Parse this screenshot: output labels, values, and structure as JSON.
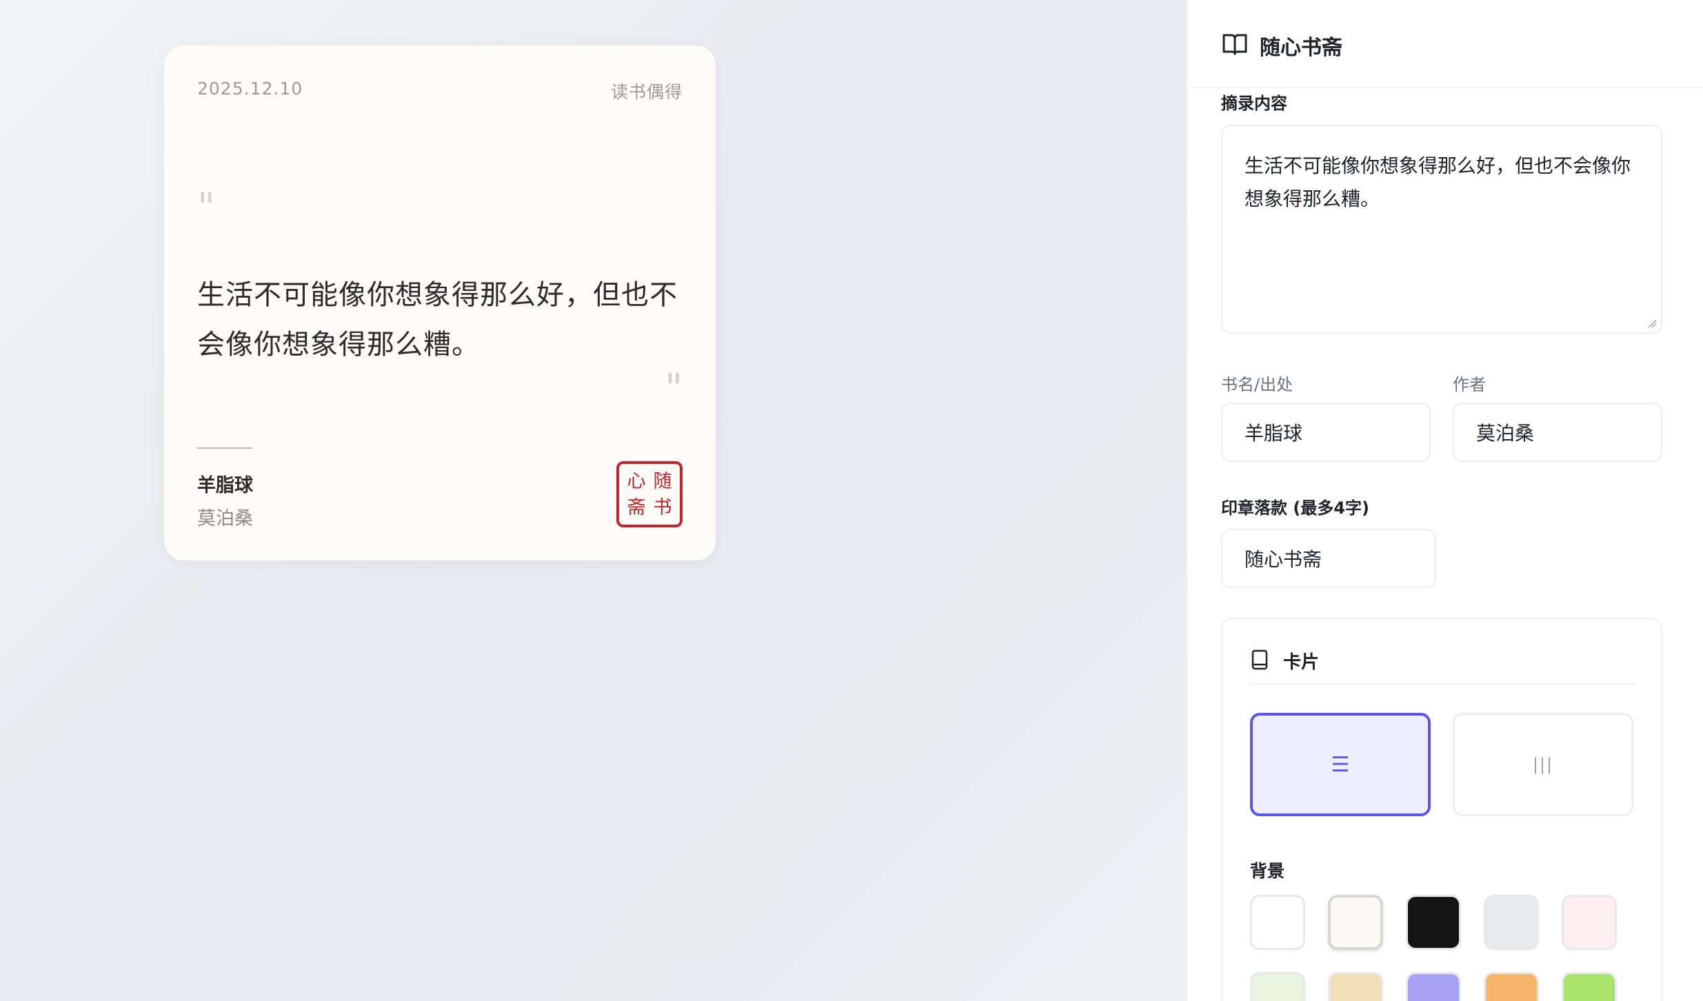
{
  "preview": {
    "date": "2025.12.10",
    "tag": "读书偶得",
    "quote_open": "\"",
    "quote_close": "\"",
    "quote": "生活不可能像你想象得那么好，但也不会像你想象得那么糟。",
    "book": "羊脂球",
    "author": "莫泊桑",
    "seal_chars": [
      "随",
      "心",
      "书",
      "斋"
    ],
    "seal_color": "#c3262a",
    "card_bg": "#fcfbf7"
  },
  "panel": {
    "app_title": "随心书斋",
    "app_icon": "open-book-icon",
    "excerpt_label": "摘录内容",
    "excerpt_value": "生活不可能像你想象得那么好，但也不会像你想象得那么糟。",
    "book_label": "书名/出处",
    "book_value": "羊脂球",
    "author_label": "作者",
    "author_value": "莫泊桑",
    "seal_label": "印章落款 (最多4字)",
    "seal_value": "随心书斋",
    "card_section": {
      "title": "卡片",
      "icon": "card-icon",
      "layouts": [
        {
          "name": "horizontal",
          "glyph": "☰",
          "selected": true
        },
        {
          "name": "vertical",
          "glyph": "|||",
          "selected": false
        }
      ],
      "accent": "#5b57e6",
      "background_label": "背景",
      "background_swatches": [
        {
          "color": "#ffffff",
          "selected": false
        },
        {
          "color": "#fbf9f3",
          "selected": true
        },
        {
          "color": "#141414",
          "selected": false
        },
        {
          "color": "#e8eaed",
          "selected": false
        },
        {
          "color": "#fdeef2",
          "selected": false
        },
        {
          "color": "#eaf5e1",
          "selected": false
        },
        {
          "color": "#f1dfb7",
          "selected": false
        },
        {
          "color": "#a7a2f3",
          "selected": false
        },
        {
          "color": "#f6b46a",
          "selected": false
        },
        {
          "color": "#a9e36c",
          "selected": false
        }
      ]
    }
  }
}
